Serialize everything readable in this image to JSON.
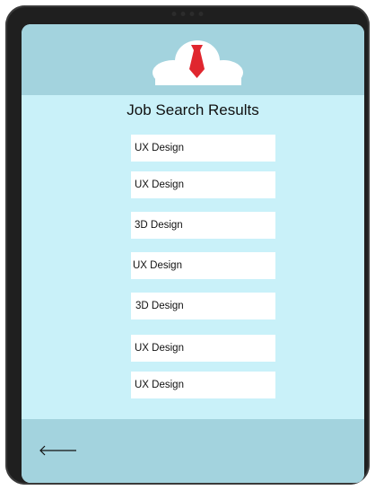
{
  "header": {
    "logo_icon": "cloud-with-necktie-logo",
    "colors": {
      "header_bg": "#a3d3de",
      "tie": "#e0262e",
      "page_bg": "#c9f1f9"
    }
  },
  "page": {
    "title": "Job Search Results"
  },
  "results": [
    {
      "label": "UX Design"
    },
    {
      "label": "UX Design"
    },
    {
      "label": "3D Design"
    },
    {
      "label": "UX Design"
    },
    {
      "label": "3D Design"
    },
    {
      "label": "UX Design"
    },
    {
      "label": "UX Design"
    }
  ],
  "footer": {
    "back_icon": "back-arrow-icon"
  }
}
